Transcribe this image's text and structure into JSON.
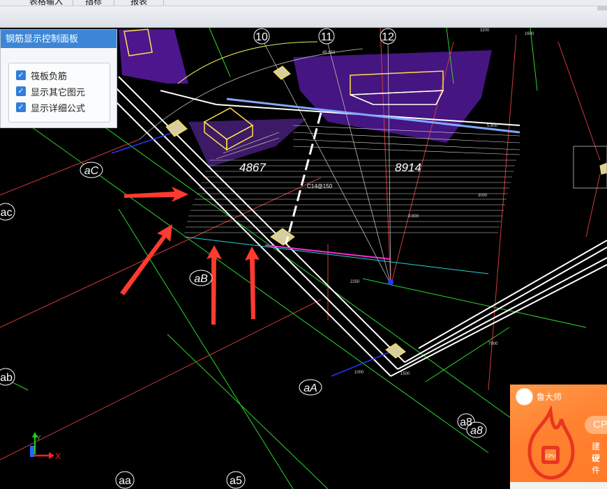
{
  "menu": {
    "tabs": [
      "表格输入",
      "指标",
      "报表"
    ]
  },
  "panel": {
    "title": "钢筋显示控制面板",
    "options": [
      {
        "label": "筏板负筋",
        "checked": true
      },
      {
        "label": "显示其它图元",
        "checked": true
      },
      {
        "label": "显示详细公式",
        "checked": true
      }
    ]
  },
  "cad": {
    "axis_numbers": [
      "10",
      "11",
      "12"
    ],
    "axis_letters": [
      "aC",
      "ac",
      "aB",
      "ab",
      "aA",
      "a8",
      "a8",
      "aa",
      "a5"
    ],
    "dimensions": [
      "4867",
      "8914"
    ],
    "rebar_label": "C14@150",
    "small_labels": [
      "3200",
      "1600",
      "45.653",
      "2250",
      "1500",
      "3000",
      "7900",
      "1000",
      "3.900",
      "5.800"
    ],
    "axis_gizmo": {
      "x_label": "X",
      "y_label": "Y"
    },
    "colors": {
      "background": "#000000",
      "wall": "#ffffff",
      "grid": "#2bd82b",
      "arrow": "#ff3b30",
      "slab_fill": "#6a1fb0",
      "highlight": "#ffe14a"
    }
  },
  "widget": {
    "name": "鲁大师",
    "badge": "CP",
    "icon": "cpu-flame-icon",
    "tip_line1": "建议",
    "tip_line2": "硬件"
  }
}
